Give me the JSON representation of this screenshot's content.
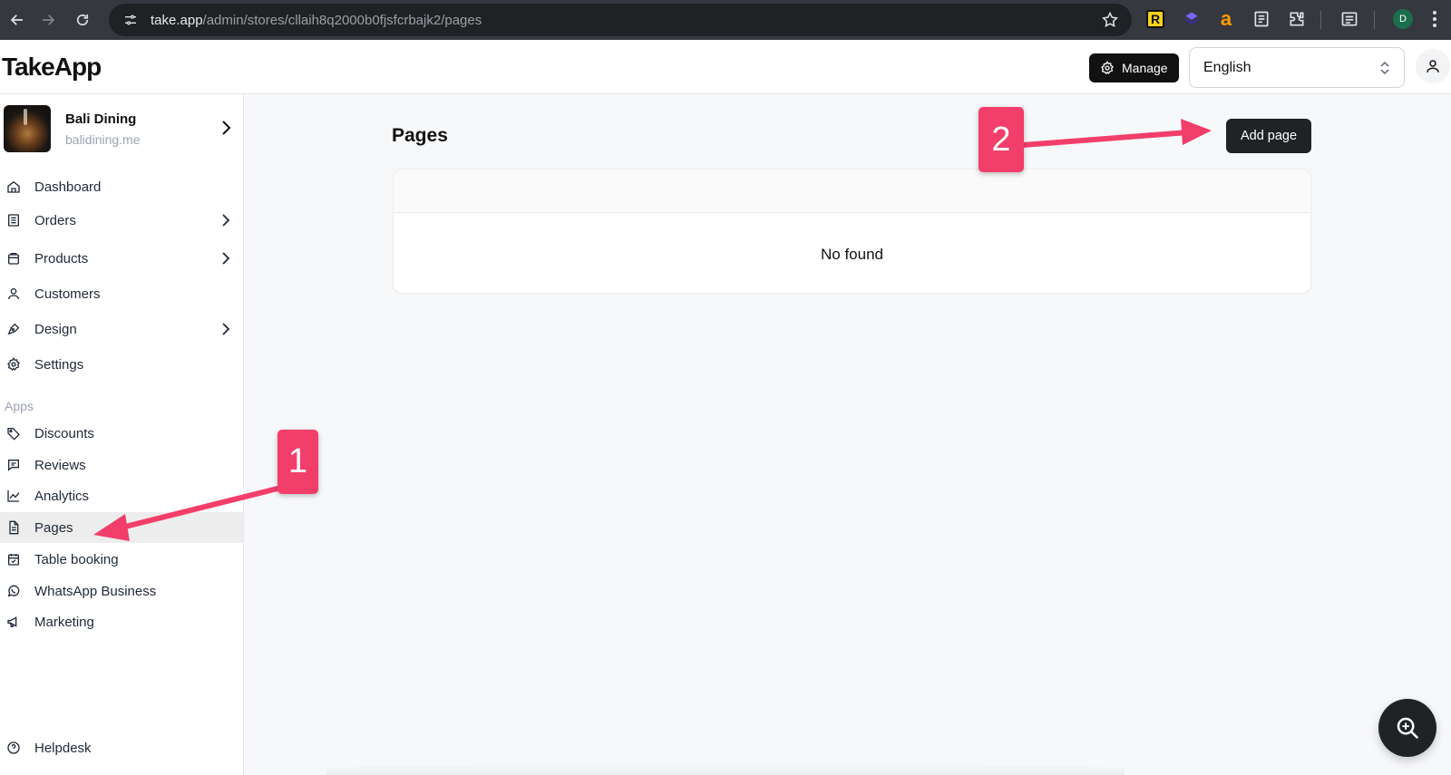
{
  "browser": {
    "url_host": "take.app",
    "url_path": "/admin/stores/cllaih8q2000b0fjsfcrbajk2/pages",
    "profile_initial": "D",
    "ext_r_label": "R",
    "ext_a_label": "a"
  },
  "header": {
    "logo": "TakeApp",
    "manage_label": "Manage",
    "language": "English"
  },
  "store": {
    "name": "Bali Dining",
    "domain": "balidining.me"
  },
  "sidebar": {
    "items": [
      {
        "label": "Dashboard"
      },
      {
        "label": "Orders"
      },
      {
        "label": "Products"
      },
      {
        "label": "Customers"
      },
      {
        "label": "Design"
      },
      {
        "label": "Settings"
      }
    ],
    "apps_heading": "Apps",
    "apps": [
      {
        "label": "Discounts"
      },
      {
        "label": "Reviews"
      },
      {
        "label": "Analytics"
      },
      {
        "label": "Pages"
      },
      {
        "label": "Table booking"
      },
      {
        "label": "WhatsApp Business"
      },
      {
        "label": "Marketing"
      }
    ],
    "helpdesk": "Helpdesk",
    "active_item": "Pages"
  },
  "main": {
    "title": "Pages",
    "add_button": "Add page",
    "empty_text": "No found"
  },
  "annotations": {
    "step1": "1",
    "step2": "2",
    "color": "#f23e6a"
  }
}
